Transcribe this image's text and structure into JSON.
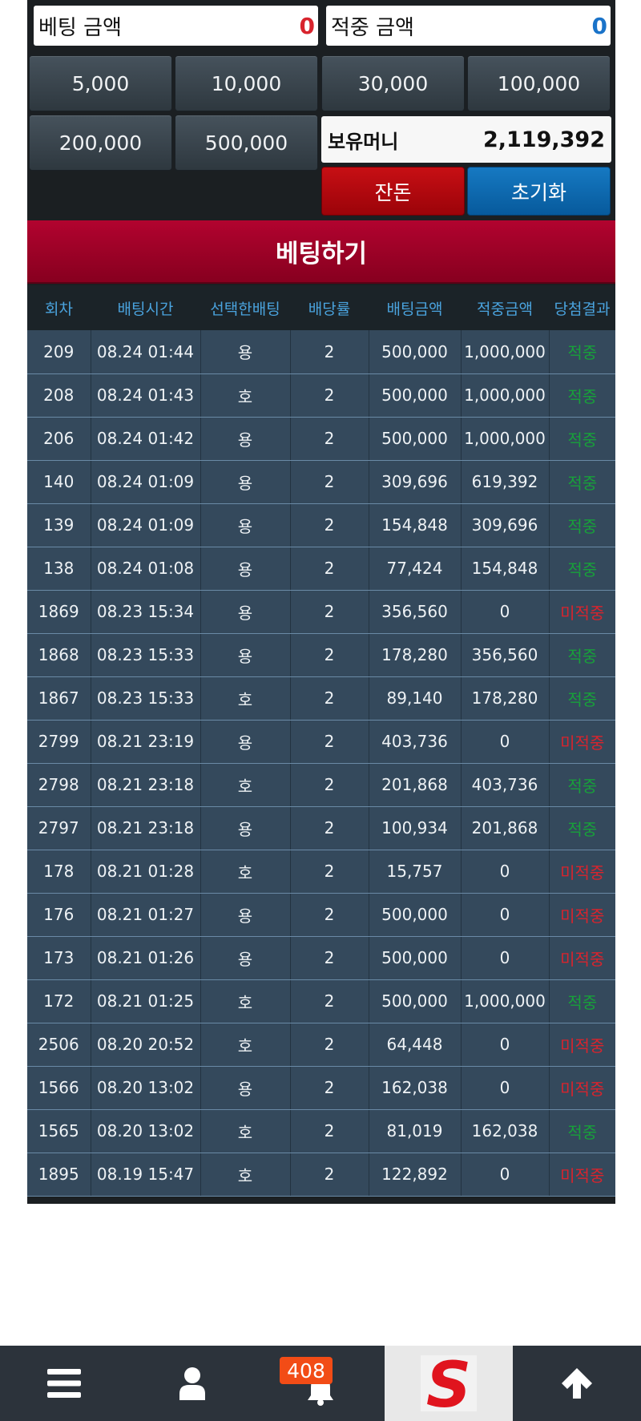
{
  "bet_amount": {
    "label": "베팅 금액",
    "value": "0"
  },
  "win_amount": {
    "label": "적중 금액",
    "value": "0"
  },
  "chips": [
    "5,000",
    "10,000",
    "30,000",
    "100,000",
    "200,000",
    "500,000"
  ],
  "balance": {
    "label": "보유머니",
    "value": "2,119,392"
  },
  "buttons": {
    "change": "잔돈",
    "reset": "초기화",
    "bet": "베팅하기"
  },
  "table": {
    "headers": [
      "회차",
      "배팅시간",
      "선택한배팅",
      "배당률",
      "배팅금액",
      "적중금액",
      "당첨결과"
    ],
    "rows": [
      [
        "209",
        "08.24 01:44",
        "용",
        "2",
        "500,000",
        "1,000,000",
        "적중"
      ],
      [
        "208",
        "08.24 01:43",
        "호",
        "2",
        "500,000",
        "1,000,000",
        "적중"
      ],
      [
        "206",
        "08.24 01:42",
        "용",
        "2",
        "500,000",
        "1,000,000",
        "적중"
      ],
      [
        "140",
        "08.24 01:09",
        "용",
        "2",
        "309,696",
        "619,392",
        "적중"
      ],
      [
        "139",
        "08.24 01:09",
        "용",
        "2",
        "154,848",
        "309,696",
        "적중"
      ],
      [
        "138",
        "08.24 01:08",
        "용",
        "2",
        "77,424",
        "154,848",
        "적중"
      ],
      [
        "1869",
        "08.23 15:34",
        "용",
        "2",
        "356,560",
        "0",
        "미적중"
      ],
      [
        "1868",
        "08.23 15:33",
        "용",
        "2",
        "178,280",
        "356,560",
        "적중"
      ],
      [
        "1867",
        "08.23 15:33",
        "호",
        "2",
        "89,140",
        "178,280",
        "적중"
      ],
      [
        "2799",
        "08.21 23:19",
        "용",
        "2",
        "403,736",
        "0",
        "미적중"
      ],
      [
        "2798",
        "08.21 23:18",
        "호",
        "2",
        "201,868",
        "403,736",
        "적중"
      ],
      [
        "2797",
        "08.21 23:18",
        "용",
        "2",
        "100,934",
        "201,868",
        "적중"
      ],
      [
        "178",
        "08.21 01:28",
        "호",
        "2",
        "15,757",
        "0",
        "미적중"
      ],
      [
        "176",
        "08.21 01:27",
        "용",
        "2",
        "500,000",
        "0",
        "미적중"
      ],
      [
        "173",
        "08.21 01:26",
        "용",
        "2",
        "500,000",
        "0",
        "미적중"
      ],
      [
        "172",
        "08.21 01:25",
        "호",
        "2",
        "500,000",
        "1,000,000",
        "적중"
      ],
      [
        "2506",
        "08.20 20:52",
        "호",
        "2",
        "64,448",
        "0",
        "미적중"
      ],
      [
        "1566",
        "08.20 13:02",
        "용",
        "2",
        "162,038",
        "0",
        "미적중"
      ],
      [
        "1565",
        "08.20 13:02",
        "호",
        "2",
        "81,019",
        "162,038",
        "적중"
      ],
      [
        "1895",
        "08.19 15:47",
        "호",
        "2",
        "122,892",
        "0",
        "미적중"
      ]
    ]
  },
  "nav": {
    "notification_count": "408",
    "logo_letter": "S"
  },
  "colors": {
    "bet_value": "#d8242d",
    "win_value": "#1a73c9",
    "result_win": "#18a03a",
    "result_lose": "#d8242d",
    "logo": "#e0141e"
  }
}
